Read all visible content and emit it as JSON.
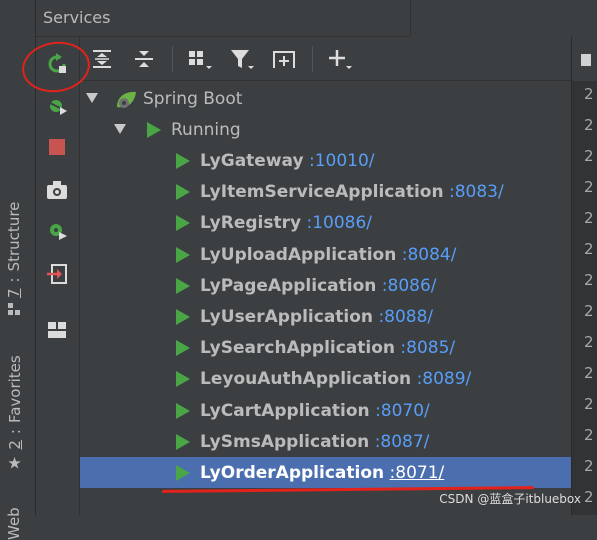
{
  "header": {
    "title": "Services"
  },
  "side_tabs": [
    {
      "id": "structure",
      "number": "7",
      "label": "Structure"
    },
    {
      "id": "favorites",
      "number": "2",
      "label": "Favorites"
    },
    {
      "id": "web",
      "label": "Web"
    }
  ],
  "tree": {
    "root": "Spring Boot",
    "group": "Running",
    "apps": [
      {
        "name": "LyGateway",
        "port": ":10010/"
      },
      {
        "name": "LyItemServiceApplication",
        "port": ":8083/"
      },
      {
        "name": "LyRegistry",
        "port": ":10086/"
      },
      {
        "name": "LyUploadApplication",
        "port": ":8084/"
      },
      {
        "name": "LyPageApplication",
        "port": ":8086/"
      },
      {
        "name": "LyUserApplication",
        "port": ":8088/"
      },
      {
        "name": "LySearchApplication",
        "port": ":8085/"
      },
      {
        "name": "LeyouAuthApplication",
        "port": ":8089/"
      },
      {
        "name": "LyCartApplication",
        "port": ":8070/"
      },
      {
        "name": "LySmsApplication",
        "port": ":8087/"
      },
      {
        "name": "LyOrderApplication",
        "port": ":8071/"
      }
    ],
    "selected_index": 10
  },
  "gutter_lines": [
    "2",
    "2",
    "2",
    "2",
    "2",
    "2",
    "2",
    "2",
    "2",
    "2",
    "2",
    "2",
    "2",
    "2",
    "2"
  ],
  "watermark": "CSDN @蓝盒子itbluebox",
  "colors": {
    "run_green": "#4aa547",
    "port_blue": "#589df6",
    "selection": "#4b6eaf",
    "annotation_red": "#e3221b",
    "stop_red": "#c75450"
  }
}
